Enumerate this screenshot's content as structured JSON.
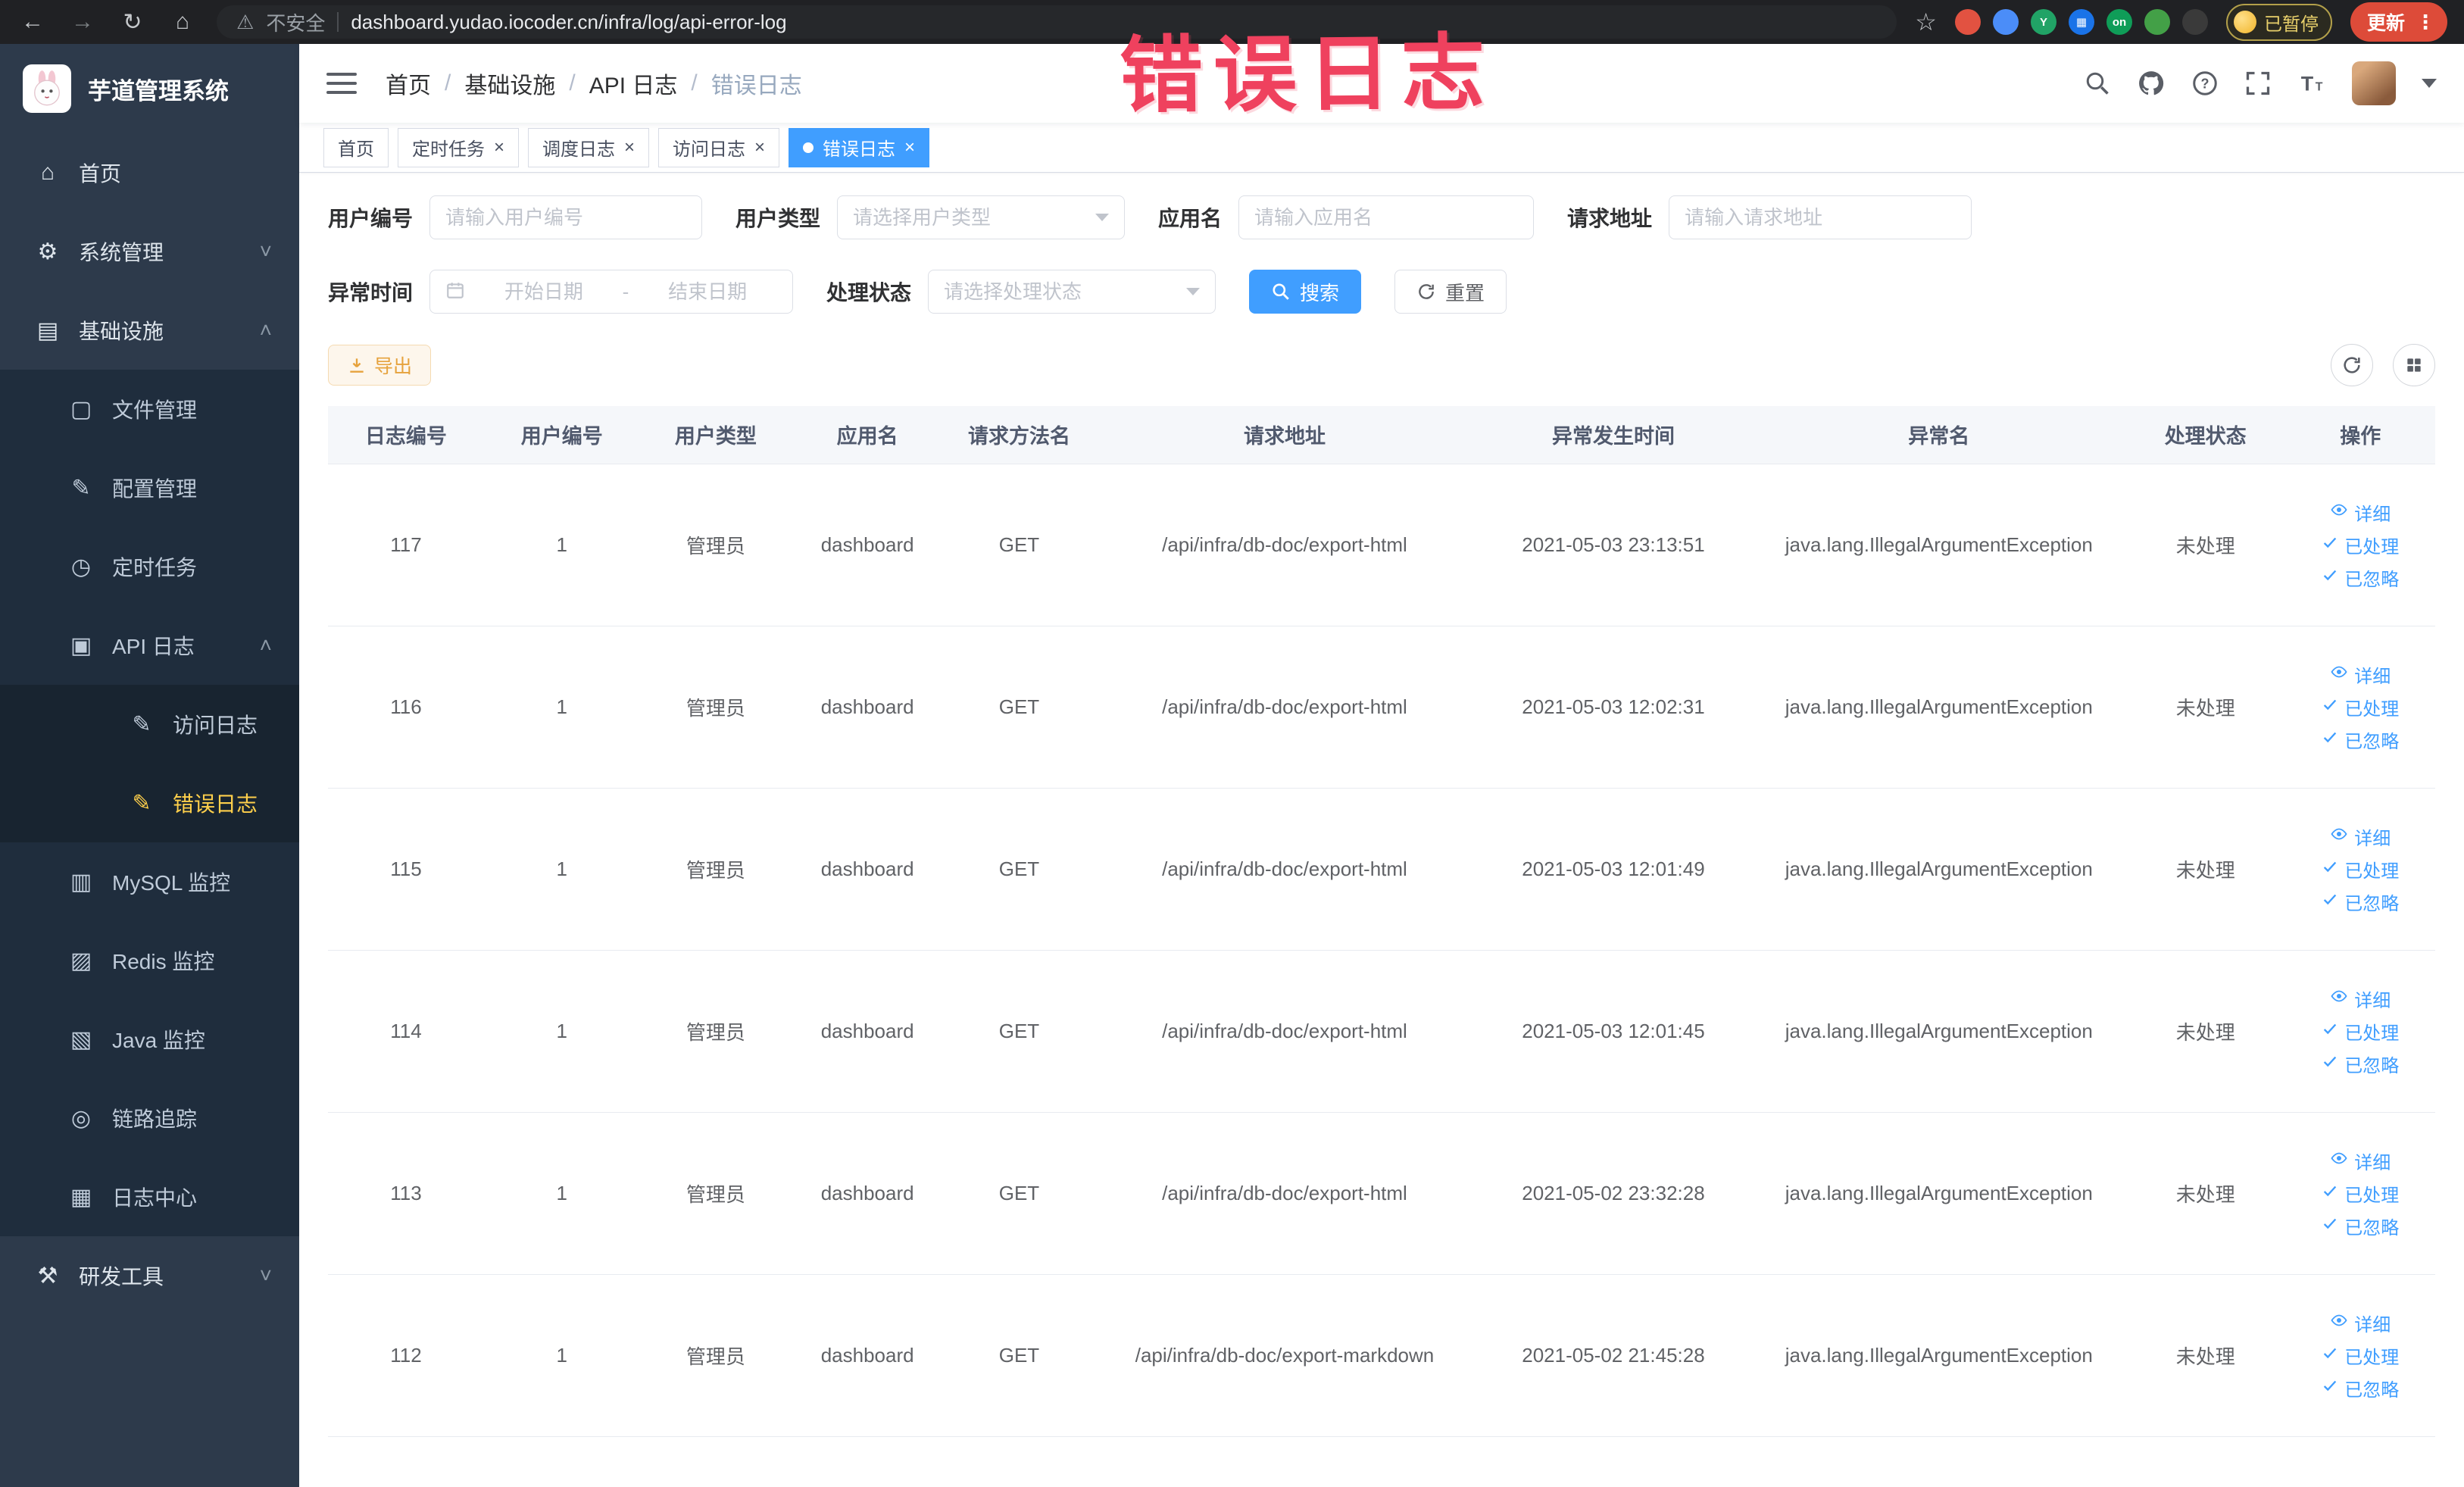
{
  "chrome": {
    "back_icon": "←",
    "forward_icon": "→",
    "reload_icon": "↻",
    "home_icon": "⌂",
    "warning_icon": "⚠",
    "security_label": "不安全",
    "url": "dashboard.yudao.iocoder.cn/infra/log/api-error-log",
    "star_icon": "☆",
    "extensions": [
      {
        "key": "extension-record",
        "color": "#e25241",
        "glyph": ""
      },
      {
        "key": "extension-drop",
        "color": "#4b8df8",
        "glyph": ""
      },
      {
        "key": "extension-y",
        "color": "#21a366",
        "glyph": "Y"
      },
      {
        "key": "extension-grid",
        "color": "#1a73e8",
        "glyph": "▦"
      },
      {
        "key": "extension-on",
        "color": "#0f9d58",
        "glyph": "on"
      },
      {
        "key": "extension-leaf",
        "color": "#43a047",
        "glyph": ""
      },
      {
        "key": "extension-paw",
        "color": "#3a3a3a",
        "glyph": ""
      }
    ],
    "paused_badge": "已暂停",
    "update_label": "更新",
    "menu_icon": "⋮"
  },
  "annotation": {
    "text": "错误日志",
    "color": "#ef415e"
  },
  "sidebar": {
    "logo_title": "芋道管理系统",
    "menu": [
      {
        "key": "home",
        "label": "首页",
        "level": 1,
        "icon": "home"
      },
      {
        "key": "system",
        "label": "系统管理",
        "level": 1,
        "icon": "gear",
        "chevron": "down"
      },
      {
        "key": "infra",
        "label": "基础设施",
        "level": 1,
        "icon": "infra",
        "chevron": "up"
      },
      {
        "key": "file",
        "label": "文件管理",
        "level": 2,
        "icon": "file"
      },
      {
        "key": "config",
        "label": "配置管理",
        "level": 2,
        "icon": "config"
      },
      {
        "key": "job",
        "label": "定时任务",
        "level": 2,
        "icon": "timer"
      },
      {
        "key": "api-log",
        "label": "API 日志",
        "level": 2,
        "icon": "api-log",
        "chevron": "up"
      },
      {
        "key": "access-log",
        "label": "访问日志",
        "level": 3,
        "icon": "doc"
      },
      {
        "key": "error-log",
        "label": "错误日志",
        "level": 3,
        "icon": "doc",
        "active": true
      },
      {
        "key": "mysql",
        "label": "MySQL 监控",
        "level": 2,
        "icon": "mysql"
      },
      {
        "key": "redis",
        "label": "Redis 监控",
        "level": 2,
        "icon": "redis"
      },
      {
        "key": "java",
        "label": "Java 监控",
        "level": 2,
        "icon": "java"
      },
      {
        "key": "trace",
        "label": "链路追踪",
        "level": 2,
        "icon": "trace"
      },
      {
        "key": "log-center",
        "label": "日志中心",
        "level": 2,
        "icon": "log-center"
      },
      {
        "key": "dev-tools",
        "label": "研发工具",
        "level": 1,
        "icon": "tools",
        "chevron": "down"
      }
    ]
  },
  "navbar": {
    "breadcrumb": [
      "首页",
      "基础设施",
      "API 日志",
      "错误日志"
    ],
    "breadcrumb_separator": "/"
  },
  "tabs": [
    {
      "key": "home",
      "label": "首页",
      "closable": false,
      "active": false
    },
    {
      "key": "job",
      "label": "定时任务",
      "closable": true,
      "active": false
    },
    {
      "key": "job-log",
      "label": "调度日志",
      "closable": true,
      "active": false
    },
    {
      "key": "access-log",
      "label": "访问日志",
      "closable": true,
      "active": false
    },
    {
      "key": "error-log",
      "label": "错误日志",
      "closable": true,
      "active": true
    }
  ],
  "filters": {
    "fields": [
      {
        "key": "user-id",
        "label": "用户编号",
        "type": "input",
        "placeholder": "请输入用户编号"
      },
      {
        "key": "user-type",
        "label": "用户类型",
        "type": "select",
        "placeholder": "请选择用户类型"
      },
      {
        "key": "app-name",
        "label": "应用名",
        "type": "input",
        "placeholder": "请输入应用名"
      },
      {
        "key": "request-url",
        "label": "请求地址",
        "type": "input",
        "placeholder": "请输入请求地址"
      },
      {
        "key": "error-time",
        "label": "异常时间",
        "type": "daterange",
        "start_placeholder": "开始日期",
        "end_placeholder": "结束日期",
        "separator": "-"
      },
      {
        "key": "status",
        "label": "处理状态",
        "type": "select",
        "placeholder": "请选择处理状态"
      }
    ],
    "search_label": "搜索",
    "reset_label": "重置"
  },
  "toolbar": {
    "export_label": "导出"
  },
  "table": {
    "headers": [
      "日志编号",
      "用户编号",
      "用户类型",
      "应用名",
      "请求方法名",
      "请求地址",
      "异常发生时间",
      "异常名",
      "处理状态",
      "操作"
    ],
    "column_keys": [
      "log-id",
      "user-id",
      "user-type",
      "app-name",
      "method",
      "request-url",
      "error-time",
      "exception-name",
      "status",
      "actions"
    ],
    "rows": [
      [
        "117",
        "1",
        "管理员",
        "dashboard",
        "GET",
        "/api/infra/db-doc/export-html",
        "2021-05-03 23:13:51",
        "java.lang.IllegalArgumentException",
        "未处理"
      ],
      [
        "116",
        "1",
        "管理员",
        "dashboard",
        "GET",
        "/api/infra/db-doc/export-html",
        "2021-05-03 12:02:31",
        "java.lang.IllegalArgumentException",
        "未处理"
      ],
      [
        "115",
        "1",
        "管理员",
        "dashboard",
        "GET",
        "/api/infra/db-doc/export-html",
        "2021-05-03 12:01:49",
        "java.lang.IllegalArgumentException",
        "未处理"
      ],
      [
        "114",
        "1",
        "管理员",
        "dashboard",
        "GET",
        "/api/infra/db-doc/export-html",
        "2021-05-03 12:01:45",
        "java.lang.IllegalArgumentException",
        "未处理"
      ],
      [
        "113",
        "1",
        "管理员",
        "dashboard",
        "GET",
        "/api/infra/db-doc/export-html",
        "2021-05-02 23:32:28",
        "java.lang.IllegalArgumentException",
        "未处理"
      ],
      [
        "112",
        "1",
        "管理员",
        "dashboard",
        "GET",
        "/api/infra/db-doc/export-markdown",
        "2021-05-02 21:45:28",
        "java.lang.IllegalArgumentException",
        "未处理"
      ]
    ],
    "actions": [
      "详细",
      "已处理",
      "已忽略"
    ]
  }
}
